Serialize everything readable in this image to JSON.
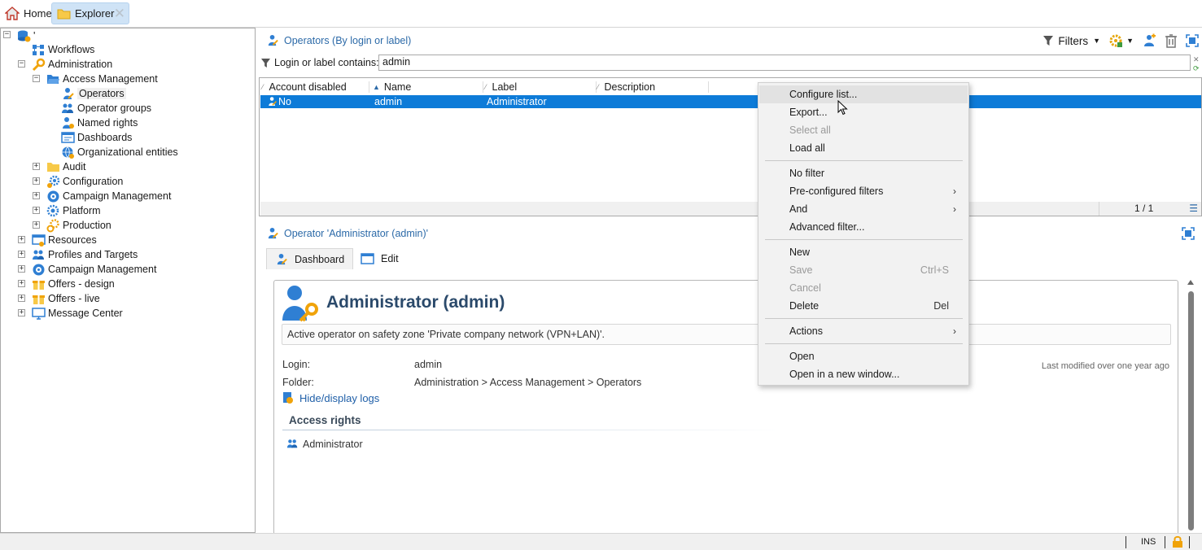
{
  "tabs": {
    "home": "Home",
    "explorer": "Explorer"
  },
  "tree": {
    "root": "'",
    "workflows": "Workflows",
    "administration": "Administration",
    "access_management": "Access Management",
    "operators": "Operators",
    "operator_groups": "Operator groups",
    "named_rights": "Named rights",
    "dashboards": "Dashboards",
    "organizational_entities": "Organizational entities",
    "audit": "Audit",
    "configuration": "Configuration",
    "campaign_management_sub": "Campaign Management",
    "platform": "Platform",
    "production": "Production",
    "resources": "Resources",
    "profiles_and_targets": "Profiles and Targets",
    "campaign_management": "Campaign Management",
    "offers_design": "Offers - design",
    "offers_live": "Offers - live",
    "message_center": "Message Center"
  },
  "list": {
    "title": "Operators (By login or label)",
    "filters_label": "Filters",
    "filter_label": "Login or label contains:",
    "filter_value": "admin",
    "columns": [
      "Account disabled",
      "Name",
      "Label",
      "Description"
    ],
    "row": {
      "account_disabled": "No",
      "name": "admin",
      "label": "Administrator"
    },
    "pagination": "1 / 1"
  },
  "detail": {
    "title": "Operator 'Administrator (admin)'",
    "tabs": [
      "Dashboard",
      "Edit"
    ],
    "name": "Administrator (admin)",
    "zone_message": "Active operator on safety zone 'Private company network (VPN+LAN)'.",
    "login_label": "Login:",
    "login_value": "admin",
    "folder_label": "Folder:",
    "folder_value": "Administration > Access Management > Operators",
    "last_modified": "Last modified over one year ago",
    "logs_link": "Hide/display logs",
    "access_rights_title": "Access rights",
    "access_rights_item": "Administrator"
  },
  "context_menu": {
    "configure_list": "Configure list...",
    "export": "Export...",
    "select_all": "Select all",
    "load_all": "Load all",
    "no_filter": "No filter",
    "preconfigured_filters": "Pre-configured filters",
    "and": "And",
    "advanced_filter": "Advanced filter...",
    "new": "New",
    "save": "Save",
    "save_shortcut": "Ctrl+S",
    "cancel": "Cancel",
    "delete": "Delete",
    "delete_shortcut": "Del",
    "actions": "Actions",
    "open": "Open",
    "open_new_window": "Open in a new window..."
  },
  "status_bar": {
    "mode": "INS"
  },
  "colors": {
    "accent_blue": "#2c6aa8",
    "selection": "#0d7bd8",
    "icon_orange": "#f0a30a"
  }
}
